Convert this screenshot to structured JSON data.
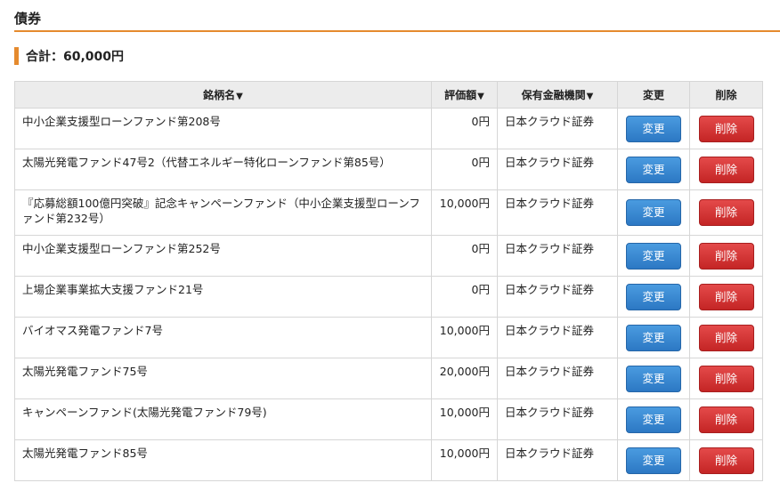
{
  "section": {
    "title": "債券"
  },
  "total": {
    "label": "合計：60,000円"
  },
  "table": {
    "headers": {
      "name": "銘柄名",
      "value": "評価額",
      "institution": "保有金融機関",
      "edit": "変更",
      "delete": "削除"
    },
    "sort_indicator": "▼",
    "rows": [
      {
        "name": "中小企業支援型ローンファンド第208号",
        "value": "0円",
        "institution": "日本クラウド証券",
        "edit": "変更",
        "delete": "削除"
      },
      {
        "name": "太陽光発電ファンド47号2（代替エネルギー特化ローンファンド第85号）",
        "value": "0円",
        "institution": "日本クラウド証券",
        "edit": "変更",
        "delete": "削除"
      },
      {
        "name": "『応募総額100億円突破』記念キャンペーンファンド（中小企業支援型ローンファンド第232号）",
        "value": "10,000円",
        "institution": "日本クラウド証券",
        "edit": "変更",
        "delete": "削除"
      },
      {
        "name": "中小企業支援型ローンファンド第252号",
        "value": "0円",
        "institution": "日本クラウド証券",
        "edit": "変更",
        "delete": "削除"
      },
      {
        "name": "上場企業事業拡大支援ファンド21号",
        "value": "0円",
        "institution": "日本クラウド証券",
        "edit": "変更",
        "delete": "削除"
      },
      {
        "name": "バイオマス発電ファンド7号",
        "value": "10,000円",
        "institution": "日本クラウド証券",
        "edit": "変更",
        "delete": "削除"
      },
      {
        "name": "太陽光発電ファンド75号",
        "value": "20,000円",
        "institution": "日本クラウド証券",
        "edit": "変更",
        "delete": "削除"
      },
      {
        "name": "キャンペーンファンド(太陽光発電ファンド79号)",
        "value": "10,000円",
        "institution": "日本クラウド証券",
        "edit": "変更",
        "delete": "削除"
      },
      {
        "name": "太陽光発電ファンド85号",
        "value": "10,000円",
        "institution": "日本クラウド証券",
        "edit": "変更",
        "delete": "削除"
      }
    ]
  },
  "colors": {
    "accent": "#e58a2e",
    "edit_button": "#2c78c4",
    "delete_button": "#c42525",
    "header_bg": "#ececec"
  }
}
